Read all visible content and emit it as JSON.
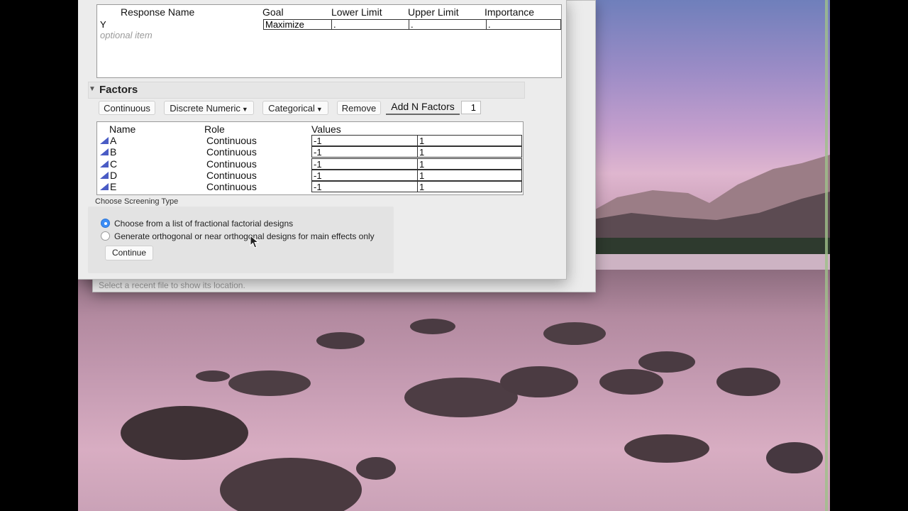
{
  "responses": {
    "headers": [
      "Response Name",
      "Goal",
      "Lower Limit",
      "Upper Limit",
      "Importance"
    ],
    "row": {
      "name": "Y",
      "goal": "Maximize",
      "lower": ".",
      "upper": ".",
      "importance": "."
    },
    "optional_placeholder": "optional item"
  },
  "factors": {
    "title": "Factors",
    "buttons": {
      "continuous": "Continuous",
      "discrete_numeric": "Discrete Numeric",
      "categorical": "Categorical",
      "remove": "Remove",
      "add_n_factors": "Add N Factors"
    },
    "add_n_value": "1",
    "headers": [
      "Name",
      "Role",
      "Values"
    ],
    "rows": [
      {
        "name": "A",
        "role": "Continuous",
        "low": "-1",
        "high": "1"
      },
      {
        "name": "B",
        "role": "Continuous",
        "low": "-1",
        "high": "1"
      },
      {
        "name": "C",
        "role": "Continuous",
        "low": "-1",
        "high": "1"
      },
      {
        "name": "D",
        "role": "Continuous",
        "low": "-1",
        "high": "1"
      },
      {
        "name": "E",
        "role": "Continuous",
        "low": "-1",
        "high": "1"
      }
    ]
  },
  "screening": {
    "label": "Choose Screening Type",
    "option1": "Choose from a list of fractional factorial designs",
    "option2": "Generate orthogonal or near orthogonal designs for main effects only",
    "selected": "option1",
    "continue_label": "Continue"
  },
  "background_window": {
    "status_text": "Select a recent file to show its location."
  },
  "colors": {
    "accent": "#3d8df5",
    "factor_icon": "#4a5cc5",
    "window_bg": "#ececec"
  }
}
